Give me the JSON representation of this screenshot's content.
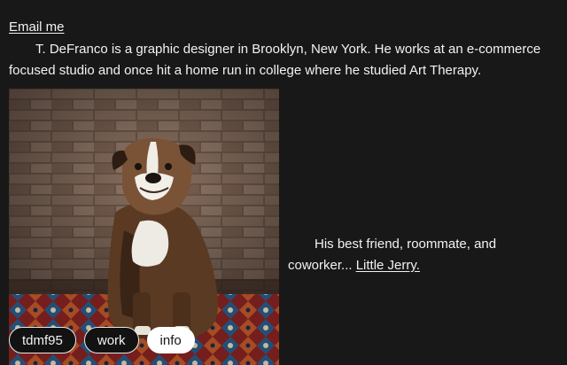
{
  "header": {
    "email_link": "Email me"
  },
  "bio": {
    "text": "T. DeFranco is a graphic designer in Brooklyn, New York. He works at an e-commerce focused studio and once hit a home run in college where he studied Art Therapy."
  },
  "photo": {
    "subject": "bulldog sitting on a patterned rug in front of a brick wall"
  },
  "caption": {
    "text": "His best friend, roommate, and coworker...",
    "link": "Little Jerry."
  },
  "nav": {
    "items": [
      {
        "label": "tdmf95",
        "active": false
      },
      {
        "label": "work",
        "active": false
      },
      {
        "label": "info",
        "active": true
      }
    ]
  }
}
